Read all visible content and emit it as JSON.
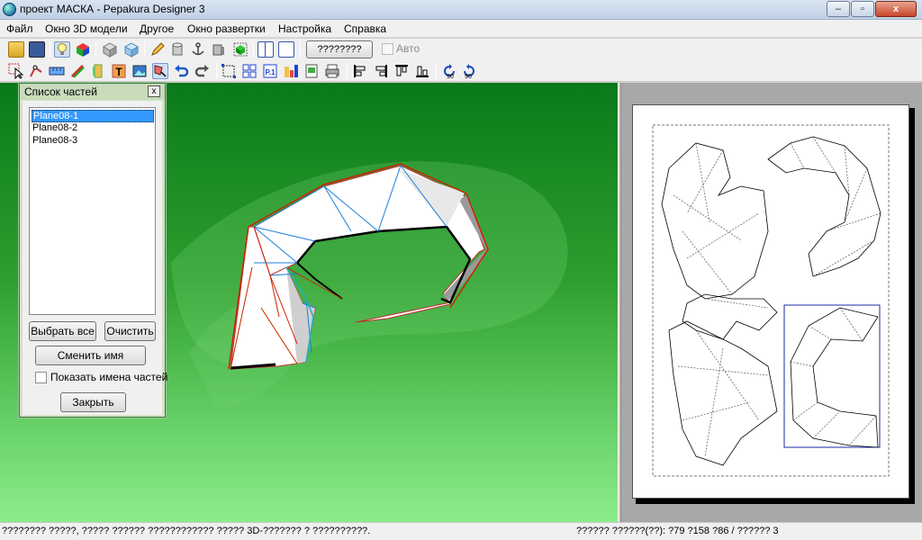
{
  "window": {
    "title": "проект МАСКА - Pepakura Designer 3",
    "minimize": "–",
    "maximize": "▫",
    "close": "x"
  },
  "menu": {
    "items": [
      "Файл",
      "Окно 3D модели",
      "Другое",
      "Окно развертки",
      "Настройка",
      "Справка"
    ]
  },
  "toolbar": {
    "unfold_button": "????????",
    "auto_label": "Авто",
    "rotate_left": "90",
    "rotate_right": "90"
  },
  "parts_panel": {
    "title": "Список частей",
    "close": "x",
    "parts": [
      {
        "label": "Plane08-1",
        "selected": true
      },
      {
        "label": "Plane08-2",
        "selected": false
      },
      {
        "label": "Plane08-3",
        "selected": false
      }
    ],
    "select_all": "Выбрать все",
    "clear": "Очистить",
    "rename": "Сменить имя",
    "show_names": "Показать имена частей",
    "show_names_checked": false,
    "close_button": "Закрыть"
  },
  "status": {
    "left": "???????? ?????, ????? ?????? ???????????? ????? 3D-??????? ? ??????????.",
    "right": "?????? ??????(??): ?79 ?158 ?86 / ?????? 3"
  },
  "colors": {
    "viewport_top": "#0a7a1a",
    "viewport_bottom": "#8cec8c",
    "edge_cut": "#cc2200",
    "edge_fold": "#1a7fdc",
    "selection": "#3399ff"
  }
}
